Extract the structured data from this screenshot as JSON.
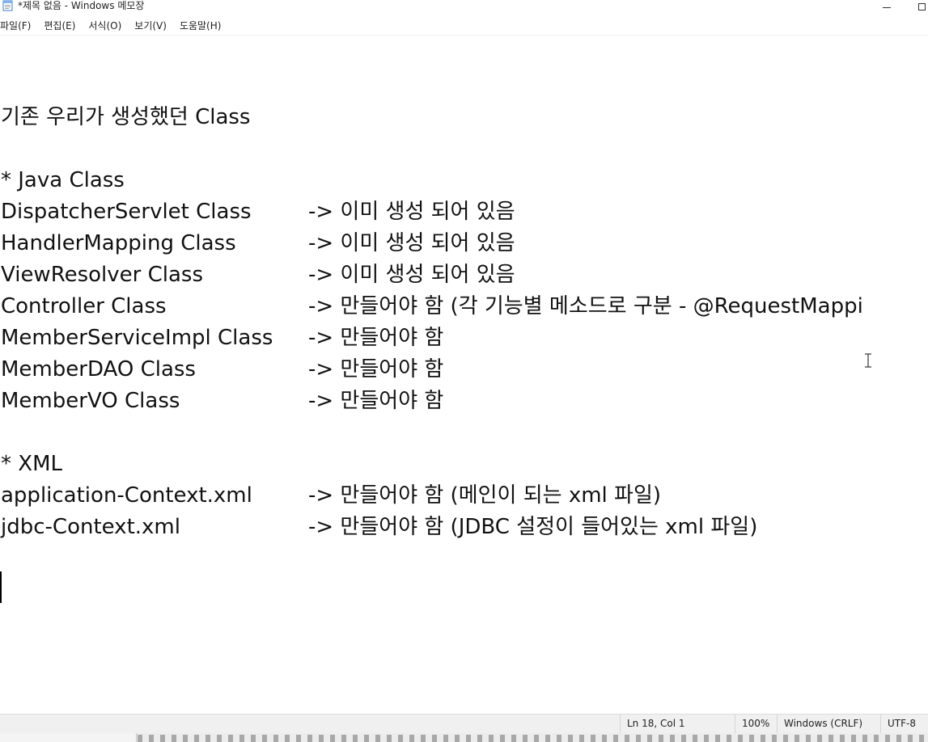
{
  "window": {
    "title": "*제목 없음 - Windows 메모장",
    "app_icon": "notepad-icon"
  },
  "menu": {
    "items": [
      "파일(F)",
      "편집(E)",
      "서식(O)",
      "보기(V)",
      "도움말(H)"
    ]
  },
  "editor": {
    "lines": [
      {
        "a": "기존 우리가 생성했던 Class",
        "b": ""
      },
      {
        "a": "* Java Class",
        "b": ""
      },
      {
        "a": "DispatcherServlet Class",
        "b": "-> 이미 생성 되어 있음"
      },
      {
        "a": "HandlerMapping Class",
        "b": "-> 이미 생성 되어 있음"
      },
      {
        "a": "ViewResolver Class",
        "b": "-> 이미 생성 되어 있음"
      },
      {
        "a": "Controller Class",
        "b": "-> 만들어야 함 (각 기능별 메소드로 구분 - @RequestMappi"
      },
      {
        "a": "MemberServiceImpl Class",
        "b": "-> 만들어야 함"
      },
      {
        "a": "MemberDAO Class",
        "b": "-> 만들어야 함"
      },
      {
        "a": "MemberVO Class",
        "b": "-> 만들어야 함"
      },
      {
        "a": "* XML",
        "b": ""
      },
      {
        "a": "application-Context.xml",
        "b": "-> 만들어야 함 (메인이 되는 xml 파일)"
      },
      {
        "a": "jdbc-Context.xml",
        "b": "-> 만들어야 함 (JDBC 설정이 들어있는 xml 파일)"
      }
    ]
  },
  "status": {
    "position": "Ln 18, Col 1",
    "zoom": "100%",
    "line_ending": "Windows (CRLF)",
    "encoding": "UTF-8"
  },
  "colors": {
    "text": "#111111",
    "statusbar_bg": "#f0f0f0"
  }
}
